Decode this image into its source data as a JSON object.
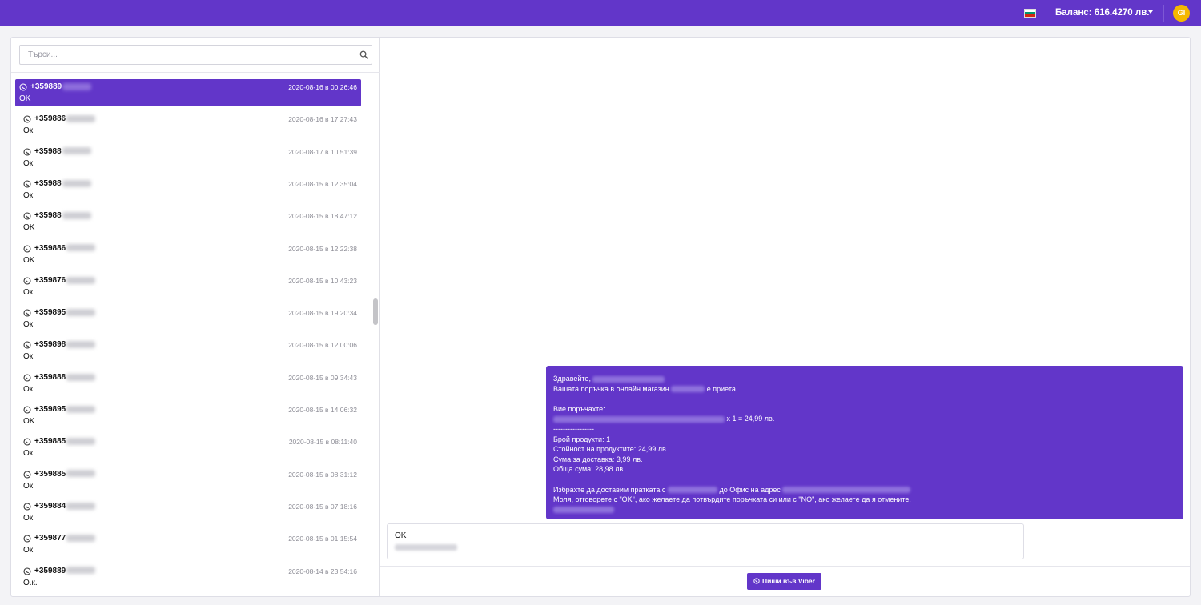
{
  "header": {
    "balance_label": "Баланс: 616.4270 лв.",
    "avatar_initials": "GI",
    "language_icon": "bulgarian-flag-icon",
    "colors": {
      "brand": "#6236c9",
      "avatar": "#f5b800"
    }
  },
  "search": {
    "placeholder": "Търси..."
  },
  "conversations": [
    {
      "phone": "+359889",
      "time": "2020-08-16 в 00:26:46",
      "preview": "OK",
      "active": true
    },
    {
      "phone": "+359886",
      "time": "2020-08-16 в 17:27:43",
      "preview": "Ок"
    },
    {
      "phone": "+35988",
      "time": "2020-08-17 в 10:51:39",
      "preview": "Ок"
    },
    {
      "phone": "+35988",
      "time": "2020-08-15 в 12:35:04",
      "preview": "Ок"
    },
    {
      "phone": "+35988",
      "time": "2020-08-15 в 18:47:12",
      "preview": "OK"
    },
    {
      "phone": "+359886",
      "time": "2020-08-15 в 12:22:38",
      "preview": "OK"
    },
    {
      "phone": "+359876",
      "time": "2020-08-15 в 10:43:23",
      "preview": "Ок"
    },
    {
      "phone": "+359895",
      "time": "2020-08-15 в 19:20:34",
      "preview": "Ок"
    },
    {
      "phone": "+359898",
      "time": "2020-08-15 в 12:00:06",
      "preview": "Ок"
    },
    {
      "phone": "+359888",
      "time": "2020-08-15 в 09:34:43",
      "preview": "Ок"
    },
    {
      "phone": "+359895",
      "time": "2020-08-15 в 14:06:32",
      "preview": "OK"
    },
    {
      "phone": "+359885",
      "time": "2020-08-15 в 08:11:40",
      "preview": "Ок"
    },
    {
      "phone": "+359885",
      "time": "2020-08-15 в 08:31:12",
      "preview": "Ок"
    },
    {
      "phone": "+359884",
      "time": "2020-08-15 в 07:18:16",
      "preview": "Ок"
    },
    {
      "phone": "+359877",
      "time": "2020-08-15 в 01:15:54",
      "preview": "Ок"
    },
    {
      "phone": "+359889",
      "time": "2020-08-14 в 23:54:16",
      "preview": "О.к."
    }
  ],
  "chat": {
    "outgoing": {
      "greeting": "Здравейте,",
      "order_prefix": "Вашата поръчка в онлайн магазин",
      "order_suffix": "е приета.",
      "ordered_label": "Вие поръчахте:",
      "item_qty": "x 1 = 24,99 лв.",
      "dashes": "-----------------",
      "product_count": "Брой продукти: 1",
      "products_value": "Стойност на продуктите: 24,99 лв.",
      "delivery_sum": "Сума за доставка: 3,99 лв.",
      "total_sum": "Обща сума: 28,98 лв.",
      "delivery_prefix": "Избрахте да доставим пратката с",
      "delivery_mid": "до Офис на адрес",
      "reply_prompt": "Моля, отговорете с \"OK\", ако желаете да потвърдите поръчката си или с \"NO\", ако желаете да я отмените."
    },
    "incoming": {
      "text": "OK"
    },
    "write_viber_button": "Пиши във Viber"
  }
}
